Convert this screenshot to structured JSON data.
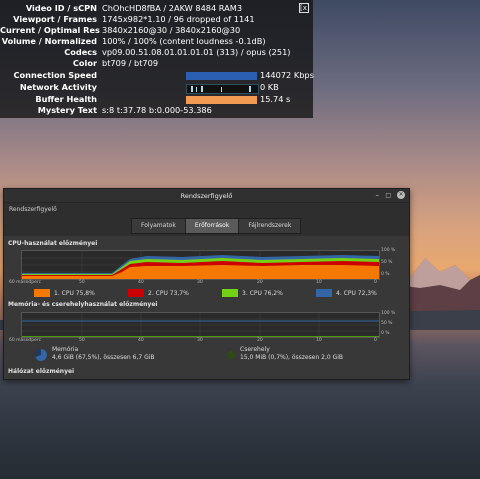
{
  "stats": {
    "close": "[x]",
    "rows": [
      {
        "k": "Video ID / sCPN",
        "v": "ChOhcHD8fBA / 2AKW 8484 RAM3"
      },
      {
        "k": "Viewport / Frames",
        "v": "1745x982*1.10 / 96 dropped of 1141"
      },
      {
        "k": "Current / Optimal Res",
        "v": "3840x2160@30 / 3840x2160@30"
      },
      {
        "k": "Volume / Normalized",
        "v": "100% / 100% (content loudness -0.1dB)"
      },
      {
        "k": "Codecs",
        "v": "vp09.00.51.08.01.01.01.01 (313) / opus (251)"
      },
      {
        "k": "Color",
        "v": "bt709 / bt709"
      }
    ],
    "connection": {
      "k": "Connection Speed",
      "v": "144072 Kbps"
    },
    "network": {
      "k": "Network Activity",
      "v": "0 KB"
    },
    "buffer": {
      "k": "Buffer Health",
      "v": "15.74 s"
    },
    "mystery": {
      "k": "Mystery Text",
      "v": "s:8 t:37.78 b:0.000-53.386"
    }
  },
  "window": {
    "title": "Rendszerfigyelő",
    "app_label": "Rendszerfigyelő",
    "tabs": [
      "Folyamatok",
      "Erőforrások",
      "Fájlrendszerek"
    ],
    "active_tab": "Erőforrások",
    "cpu_title": "CPU-használat előzményei",
    "mem_title": "Memória- és cserehelyhasználat előzményei",
    "net_title": "Hálózat előzményei",
    "axis": {
      "seconds": "60 másodperc",
      "t50": "50",
      "t40": "40",
      "t30": "30",
      "t20": "20",
      "t10": "10",
      "t0": "0",
      "p100": "100 %",
      "p50": "50 %",
      "p0": "0 %"
    },
    "cpus": [
      {
        "label": "1. CPU",
        "value": "75,8%",
        "color": "#f57900"
      },
      {
        "label": "2. CPU",
        "value": "73,7%",
        "color": "#cc0000"
      },
      {
        "label": "3. CPU",
        "value": "76,2%",
        "color": "#73d216"
      },
      {
        "label": "4. CPU",
        "value": "72,3%",
        "color": "#3465a4"
      }
    ],
    "memory": {
      "label": "Memória",
      "detail": "4,6 GiB (67,5%), összesen 6,7 GiB",
      "color": "#3465a4"
    },
    "swap": {
      "label": "Cserehely",
      "detail": "15,0 MiB (0,7%), összesen 2,0 GiB",
      "color": "#4e9a06"
    }
  }
}
